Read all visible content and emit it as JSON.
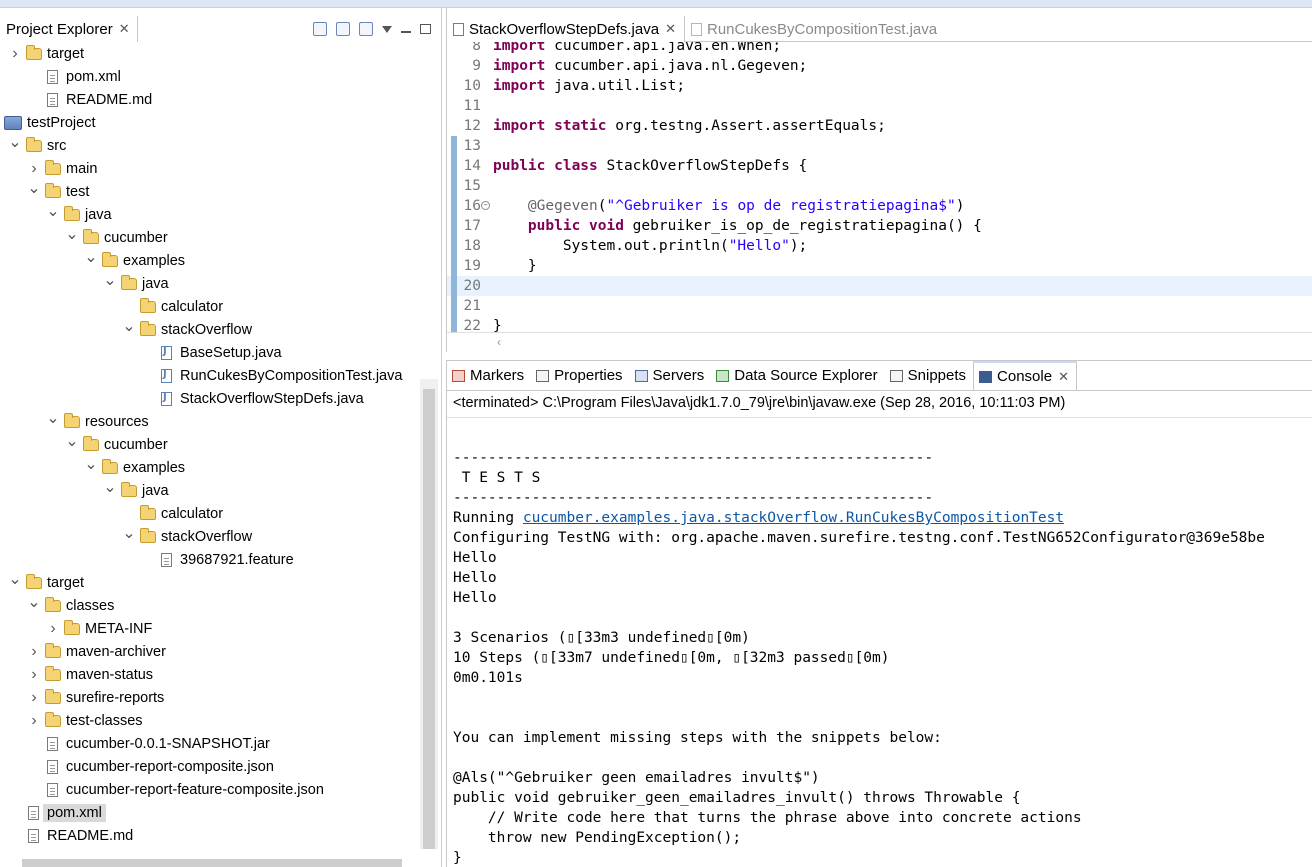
{
  "explorer": {
    "title": "Project Explorer",
    "tree": [
      {
        "label": "target",
        "type": "folder",
        "depth": 0,
        "arrow": "right"
      },
      {
        "label": "pom.xml",
        "type": "file",
        "depth": 1,
        "arrow": "none"
      },
      {
        "label": "README.md",
        "type": "file",
        "depth": 1,
        "arrow": "none"
      },
      {
        "label": "testProject",
        "type": "project",
        "depth": -1,
        "arrow": "none"
      },
      {
        "label": "src",
        "type": "folder",
        "depth": 0,
        "arrow": "down"
      },
      {
        "label": "main",
        "type": "folder",
        "depth": 1,
        "arrow": "right"
      },
      {
        "label": "test",
        "type": "folder",
        "depth": 1,
        "arrow": "down"
      },
      {
        "label": "java",
        "type": "folder",
        "depth": 2,
        "arrow": "down"
      },
      {
        "label": "cucumber",
        "type": "folder",
        "depth": 3,
        "arrow": "down"
      },
      {
        "label": "examples",
        "type": "folder",
        "depth": 4,
        "arrow": "down"
      },
      {
        "label": "java",
        "type": "folder",
        "depth": 5,
        "arrow": "down"
      },
      {
        "label": "calculator",
        "type": "folder",
        "depth": 6,
        "arrow": "none"
      },
      {
        "label": "stackOverflow",
        "type": "folder",
        "depth": 6,
        "arrow": "down"
      },
      {
        "label": "BaseSetup.java",
        "type": "java",
        "depth": 7,
        "arrow": "none"
      },
      {
        "label": "RunCukesByCompositionTest.java",
        "type": "java",
        "depth": 7,
        "arrow": "none"
      },
      {
        "label": "StackOverflowStepDefs.java",
        "type": "java",
        "depth": 7,
        "arrow": "none"
      },
      {
        "label": "resources",
        "type": "folder",
        "depth": 2,
        "arrow": "down"
      },
      {
        "label": "cucumber",
        "type": "folder",
        "depth": 3,
        "arrow": "down"
      },
      {
        "label": "examples",
        "type": "folder",
        "depth": 4,
        "arrow": "down"
      },
      {
        "label": "java",
        "type": "folder",
        "depth": 5,
        "arrow": "down"
      },
      {
        "label": "calculator",
        "type": "folder",
        "depth": 6,
        "arrow": "none"
      },
      {
        "label": "stackOverflow",
        "type": "folder",
        "depth": 6,
        "arrow": "down"
      },
      {
        "label": "39687921.feature",
        "type": "file",
        "depth": 7,
        "arrow": "none"
      },
      {
        "label": "target",
        "type": "folder",
        "depth": 0,
        "arrow": "down"
      },
      {
        "label": "classes",
        "type": "folder",
        "depth": 1,
        "arrow": "down"
      },
      {
        "label": "META-INF",
        "type": "folder",
        "depth": 2,
        "arrow": "right"
      },
      {
        "label": "maven-archiver",
        "type": "folder",
        "depth": 1,
        "arrow": "right"
      },
      {
        "label": "maven-status",
        "type": "folder",
        "depth": 1,
        "arrow": "right"
      },
      {
        "label": "surefire-reports",
        "type": "folder",
        "depth": 1,
        "arrow": "right"
      },
      {
        "label": "test-classes",
        "type": "folder",
        "depth": 1,
        "arrow": "right"
      },
      {
        "label": "cucumber-0.0.1-SNAPSHOT.jar",
        "type": "file",
        "depth": 1,
        "arrow": "none"
      },
      {
        "label": "cucumber-report-composite.json",
        "type": "file",
        "depth": 1,
        "arrow": "none"
      },
      {
        "label": "cucumber-report-feature-composite.json",
        "type": "file",
        "depth": 1,
        "arrow": "none"
      },
      {
        "label": "pom.xml",
        "type": "file",
        "depth": 0,
        "arrow": "none",
        "selected": true
      },
      {
        "label": "README.md",
        "type": "file",
        "depth": 0,
        "arrow": "none"
      }
    ]
  },
  "editor": {
    "tabs": [
      {
        "label": "StackOverflowStepDefs.java",
        "active": true
      },
      {
        "label": "RunCukesByCompositionTest.java",
        "active": false
      }
    ],
    "lines": [
      {
        "n": "8",
        "segs": [
          [
            "kw",
            "import"
          ],
          [
            "",
            " cucumber.api.java.en.When;"
          ]
        ]
      },
      {
        "n": "9",
        "segs": [
          [
            "kw",
            "import"
          ],
          [
            "",
            " cucumber.api.java.nl.Gegeven;"
          ]
        ]
      },
      {
        "n": "10",
        "segs": [
          [
            "kw",
            "import"
          ],
          [
            "",
            " java.util.List;"
          ]
        ]
      },
      {
        "n": "11",
        "segs": []
      },
      {
        "n": "12",
        "segs": [
          [
            "kw",
            "import static"
          ],
          [
            "",
            " org.testng.Assert.assertEquals;"
          ]
        ]
      },
      {
        "n": "13",
        "segs": []
      },
      {
        "n": "14",
        "segs": [
          [
            "kw",
            "public class"
          ],
          [
            "",
            " StackOverflowStepDefs {"
          ]
        ]
      },
      {
        "n": "15",
        "segs": []
      },
      {
        "n": "16",
        "segs": [
          [
            "",
            "    "
          ],
          [
            "ann",
            "@Gegeven"
          ],
          [
            "",
            "("
          ],
          [
            "str",
            "\"^Gebruiker is op de registratiepagina$\""
          ],
          [
            "",
            ")"
          ]
        ]
      },
      {
        "n": "17",
        "segs": [
          [
            "",
            "    "
          ],
          [
            "kw",
            "public void"
          ],
          [
            "",
            " gebruiker_is_op_de_registratiepagina() {"
          ]
        ]
      },
      {
        "n": "18",
        "segs": [
          [
            "",
            "        System.out.println("
          ],
          [
            "str",
            "\"Hello\""
          ],
          [
            "",
            ");"
          ]
        ]
      },
      {
        "n": "19",
        "segs": [
          [
            "",
            "    }"
          ]
        ]
      },
      {
        "n": "20",
        "segs": []
      },
      {
        "n": "21",
        "segs": []
      },
      {
        "n": "22",
        "segs": [
          [
            "",
            "}"
          ]
        ]
      }
    ]
  },
  "panel": {
    "tabs": [
      {
        "label": "Markers",
        "icon": "markers-icon",
        "active": false
      },
      {
        "label": "Properties",
        "icon": "properties-icon",
        "active": false
      },
      {
        "label": "Servers",
        "icon": "servers-icon",
        "active": false
      },
      {
        "label": "Data Source Explorer",
        "icon": "data-source-explorer-icon",
        "active": false
      },
      {
        "label": "Snippets",
        "icon": "snippets-icon",
        "active": false
      },
      {
        "label": "Console",
        "icon": "console-icon",
        "active": true
      }
    ],
    "terminated": "<terminated> C:\\Program Files\\Java\\jdk1.7.0_79\\jre\\bin\\javaw.exe (Sep 28, 2016, 10:11:03 PM)",
    "console": [
      "",
      "-------------------------------------------------------",
      " T E S T S",
      "-------------------------------------------------------",
      "Running |LINK|cucumber.examples.java.stackOverflow.RunCukesByCompositionTest",
      "Configuring TestNG with: org.apache.maven.surefire.testng.conf.TestNG652Configurator@369e58be",
      "Hello",
      "Hello",
      "Hello",
      "",
      "3 Scenarios (▯[33m3 undefined▯[0m)",
      "10 Steps (▯[33m7 undefined▯[0m, ▯[32m3 passed▯[0m)",
      "0m0.101s",
      "",
      "",
      "You can implement missing steps with the snippets below:",
      "",
      "@Als(\"^Gebruiker geen emailadres invult$\")",
      "public void gebruiker_geen_emailadres_invult() throws Throwable {",
      "    |COM|// Write code here that turns the phrase above into concrete actions",
      "    throw new PendingException();",
      "}"
    ]
  }
}
